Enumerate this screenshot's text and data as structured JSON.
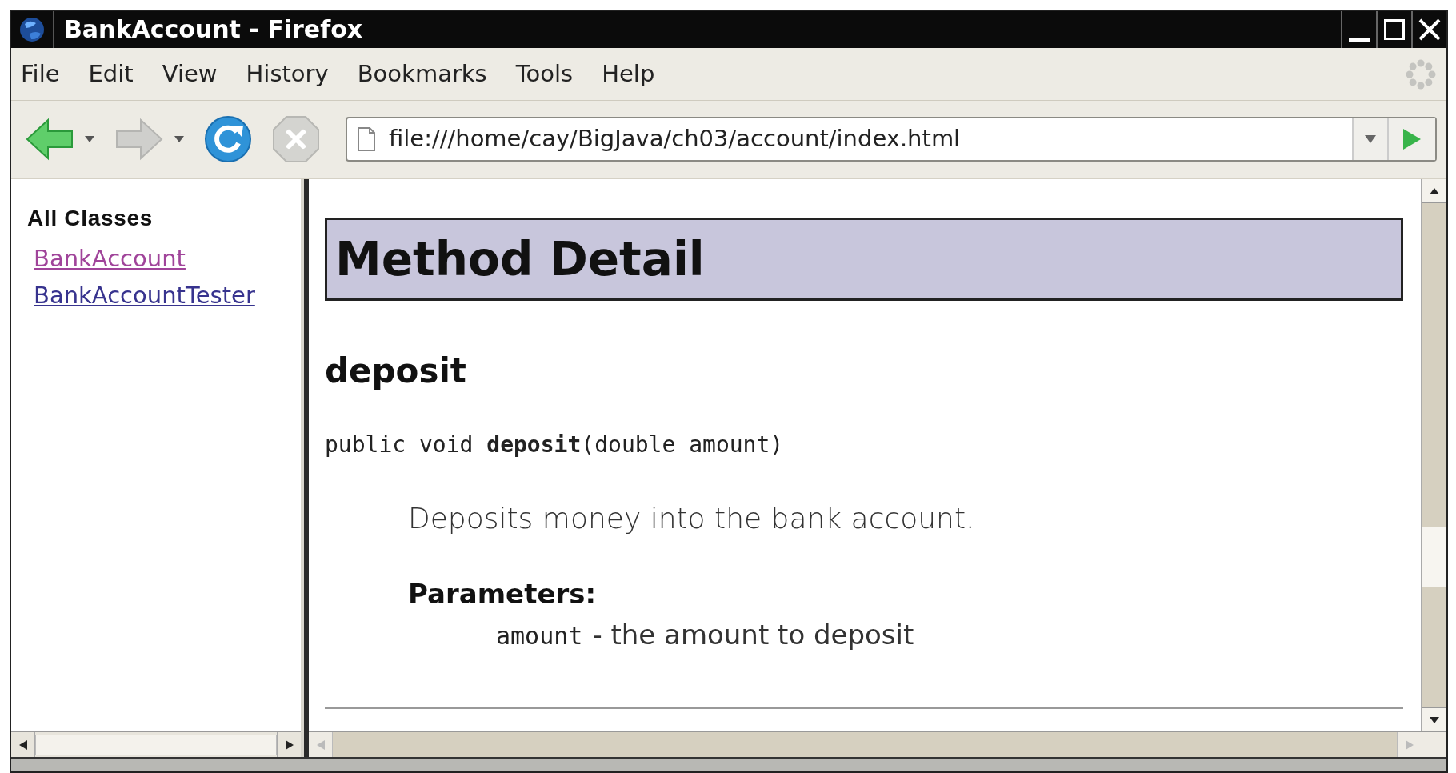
{
  "window": {
    "title": "BankAccount - Firefox"
  },
  "menu": [
    "File",
    "Edit",
    "View",
    "History",
    "Bookmarks",
    "Tools",
    "Help"
  ],
  "toolbar": [
    {
      "kind": "back",
      "disabled": false
    },
    {
      "kind": "forward",
      "disabled": true
    },
    {
      "kind": "reload",
      "disabled": false
    },
    {
      "kind": "stop",
      "disabled": true
    }
  ],
  "address": {
    "value": "file:///home/cay/BigJava/ch03/account/index.html"
  },
  "sidebar": {
    "heading": "All Classes",
    "links": [
      {
        "label": "BankAccount",
        "visited": true
      },
      {
        "label": "BankAccountTester",
        "visited": false
      }
    ]
  },
  "main": {
    "section_title": "Method Detail",
    "method_name": "deposit",
    "signature": "public void **deposit**(double amount)",
    "description": "Deposits money into the bank account.",
    "params_label": "Parameters:",
    "params": [
      {
        "name": "amount",
        "description": "- the amount to deposit"
      }
    ]
  }
}
